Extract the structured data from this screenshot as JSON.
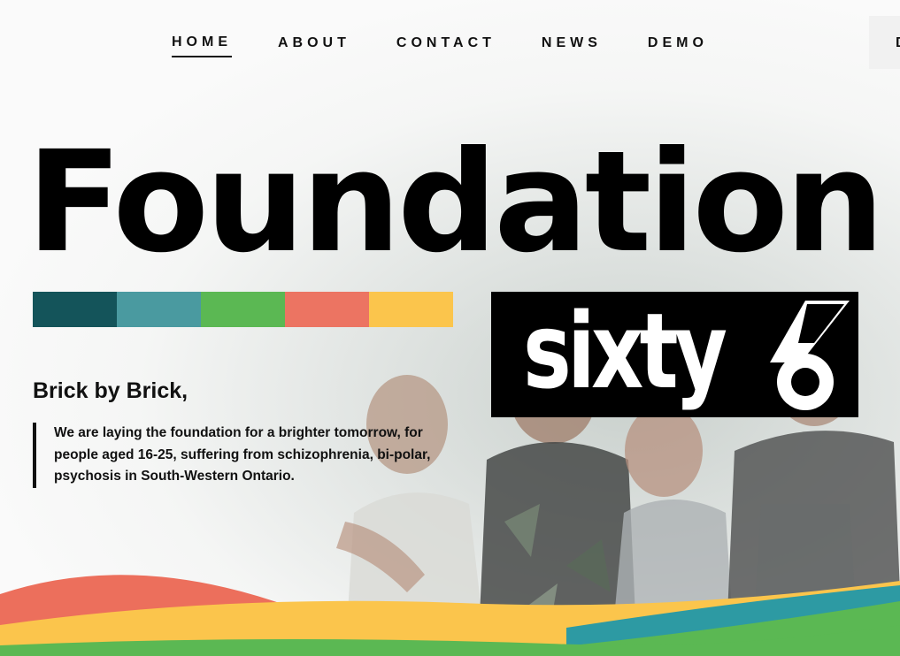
{
  "nav": {
    "items": [
      {
        "label": "HOME",
        "active": true
      },
      {
        "label": "ABOUT",
        "active": false
      },
      {
        "label": "CONTACT",
        "active": false
      },
      {
        "label": "NEWS",
        "active": false
      },
      {
        "label": "DEMO",
        "active": false
      }
    ],
    "overflow_label": "D"
  },
  "hero": {
    "title": "Foundation",
    "logo_text": "sixty",
    "logo_mark": "6",
    "subtitle": "Brick by Brick,",
    "quote": "We are laying the foundation for a brighter tomorrow, for people aged 16-25, suffering from schizophrenia, bi-polar, psychosis in South-Western Ontario."
  },
  "colors": {
    "stripe": [
      "#14545a",
      "#4a9aa0",
      "#5bb853",
      "#ec7462",
      "#fbc54c"
    ],
    "wave_red": "#ec6f5c",
    "wave_yellow": "#fbc54c",
    "wave_green": "#5bb853",
    "wave_teal": "#2d9aa3"
  },
  "icons": {
    "logo_mark_icon": "sixty6-logo-six"
  }
}
